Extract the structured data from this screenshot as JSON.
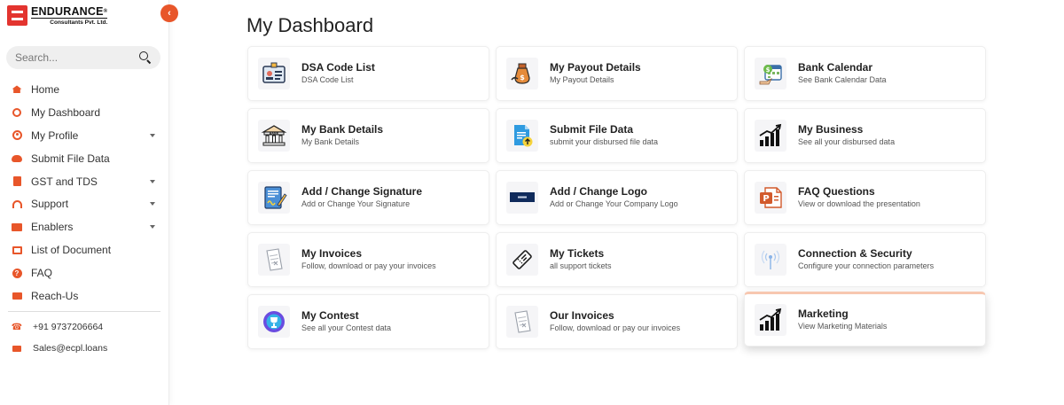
{
  "brand": {
    "name": "ENDURANCE",
    "registered": "®",
    "subtitle": "Consultants Pvt. Ltd."
  },
  "search": {
    "placeholder": "Search..."
  },
  "sidebar": {
    "items": [
      {
        "label": "Home",
        "icon": "home-icon",
        "has_submenu": false
      },
      {
        "label": "My Dashboard",
        "icon": "circle-icon",
        "has_submenu": false
      },
      {
        "label": "My Profile",
        "icon": "user-icon",
        "has_submenu": true
      },
      {
        "label": "Submit File Data",
        "icon": "cloud-upload-icon",
        "has_submenu": false
      },
      {
        "label": "GST and TDS",
        "icon": "file-icon",
        "has_submenu": true
      },
      {
        "label": "Support",
        "icon": "headset-icon",
        "has_submenu": true
      },
      {
        "label": "Enablers",
        "icon": "briefcase-icon",
        "has_submenu": true
      },
      {
        "label": "List of Document",
        "icon": "list-icon",
        "has_submenu": false
      },
      {
        "label": "FAQ",
        "icon": "question-icon",
        "has_submenu": false
      },
      {
        "label": "Reach-Us",
        "icon": "envelope-icon",
        "has_submenu": false
      }
    ],
    "contact": {
      "phone": "+91 9737206664",
      "email": "Sales@ecpl.loans"
    }
  },
  "main": {
    "title": "My Dashboard",
    "cards": [
      {
        "title": "DSA Code List",
        "subtitle": "DSA Code List",
        "icon": "id-card-icon"
      },
      {
        "title": "My Payout Details",
        "subtitle": "My Payout Details",
        "icon": "money-bag-icon"
      },
      {
        "title": "Bank Calendar",
        "subtitle": "See Bank Calendar Data",
        "icon": "calendar-icon"
      },
      {
        "title": "My Bank Details",
        "subtitle": "My Bank Details",
        "icon": "bank-icon"
      },
      {
        "title": "Submit File Data",
        "subtitle": "submit your disbursed file data",
        "icon": "file-upload-icon"
      },
      {
        "title": "My Business",
        "subtitle": "See all your disbursed data",
        "icon": "growth-chart-icon"
      },
      {
        "title": "Add / Change Signature",
        "subtitle": "Add or Change Your Signature",
        "icon": "signature-icon"
      },
      {
        "title": "Add / Change Logo",
        "subtitle": "Add or Change Your Company Logo",
        "icon": "logo-banner-icon"
      },
      {
        "title": "FAQ Questions",
        "subtitle": "View or download the presentation",
        "icon": "powerpoint-icon"
      },
      {
        "title": "My Invoices",
        "subtitle": "Follow, download or pay your invoices",
        "icon": "invoice-icon"
      },
      {
        "title": "My Tickets",
        "subtitle": "all support tickets",
        "icon": "ticket-icon"
      },
      {
        "title": "Connection & Security",
        "subtitle": "Configure your connection parameters",
        "icon": "signal-icon"
      },
      {
        "title": "My Contest",
        "subtitle": "See all your Contest data",
        "icon": "trophy-icon"
      },
      {
        "title": "Our Invoices",
        "subtitle": "Follow, download or pay our invoices",
        "icon": "invoice-icon"
      },
      {
        "title": "Marketing",
        "subtitle": "View Marketing Materials",
        "icon": "growth-chart-icon"
      }
    ]
  },
  "colors": {
    "accent": "#e8562a",
    "brand_red": "#e3342f"
  }
}
